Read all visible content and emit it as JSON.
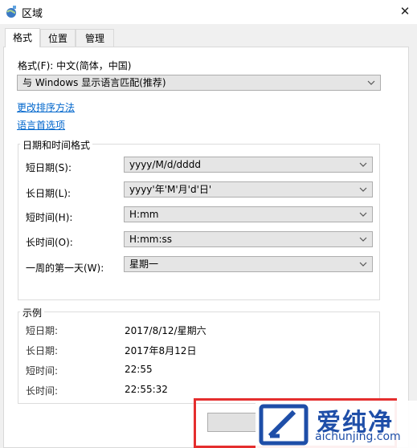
{
  "window": {
    "title": "区域"
  },
  "tabs": [
    {
      "label": "格式",
      "active": true
    },
    {
      "label": "位置",
      "active": false
    },
    {
      "label": "管理",
      "active": false
    }
  ],
  "format": {
    "label": "格式(F): 中文(简体，中国)",
    "dropdown_value": "与 Windows 显示语言匹配(推荐)"
  },
  "links": {
    "sort": "更改排序方法",
    "language_prefs": "语言首选项"
  },
  "datetime": {
    "group_title": "日期和时间格式",
    "rows": [
      {
        "label": "短日期(S):",
        "value": "yyyy/M/d/dddd"
      },
      {
        "label": "长日期(L):",
        "value": "yyyy'年'M'月'd'日'"
      },
      {
        "label": "短时间(H):",
        "value": "H:mm"
      },
      {
        "label": "长时间(O):",
        "value": "H:mm:ss"
      },
      {
        "label": "一周的第一天(W):",
        "value": "星期一"
      }
    ]
  },
  "examples": {
    "group_title": "示例",
    "rows": [
      {
        "label": "短日期:",
        "value": "2017/8/12/星期六"
      },
      {
        "label": "长日期:",
        "value": "2017年8月12日"
      },
      {
        "label": "短时间:",
        "value": "22:55"
      },
      {
        "label": "长时间:",
        "value": "22:55:32"
      }
    ]
  },
  "watermark": {
    "title": "爱纯净",
    "url": "aichunjing.com"
  },
  "colors": {
    "link": "#0066cc",
    "highlight_border": "#e52e2e",
    "watermark": "#1e4ea8"
  }
}
